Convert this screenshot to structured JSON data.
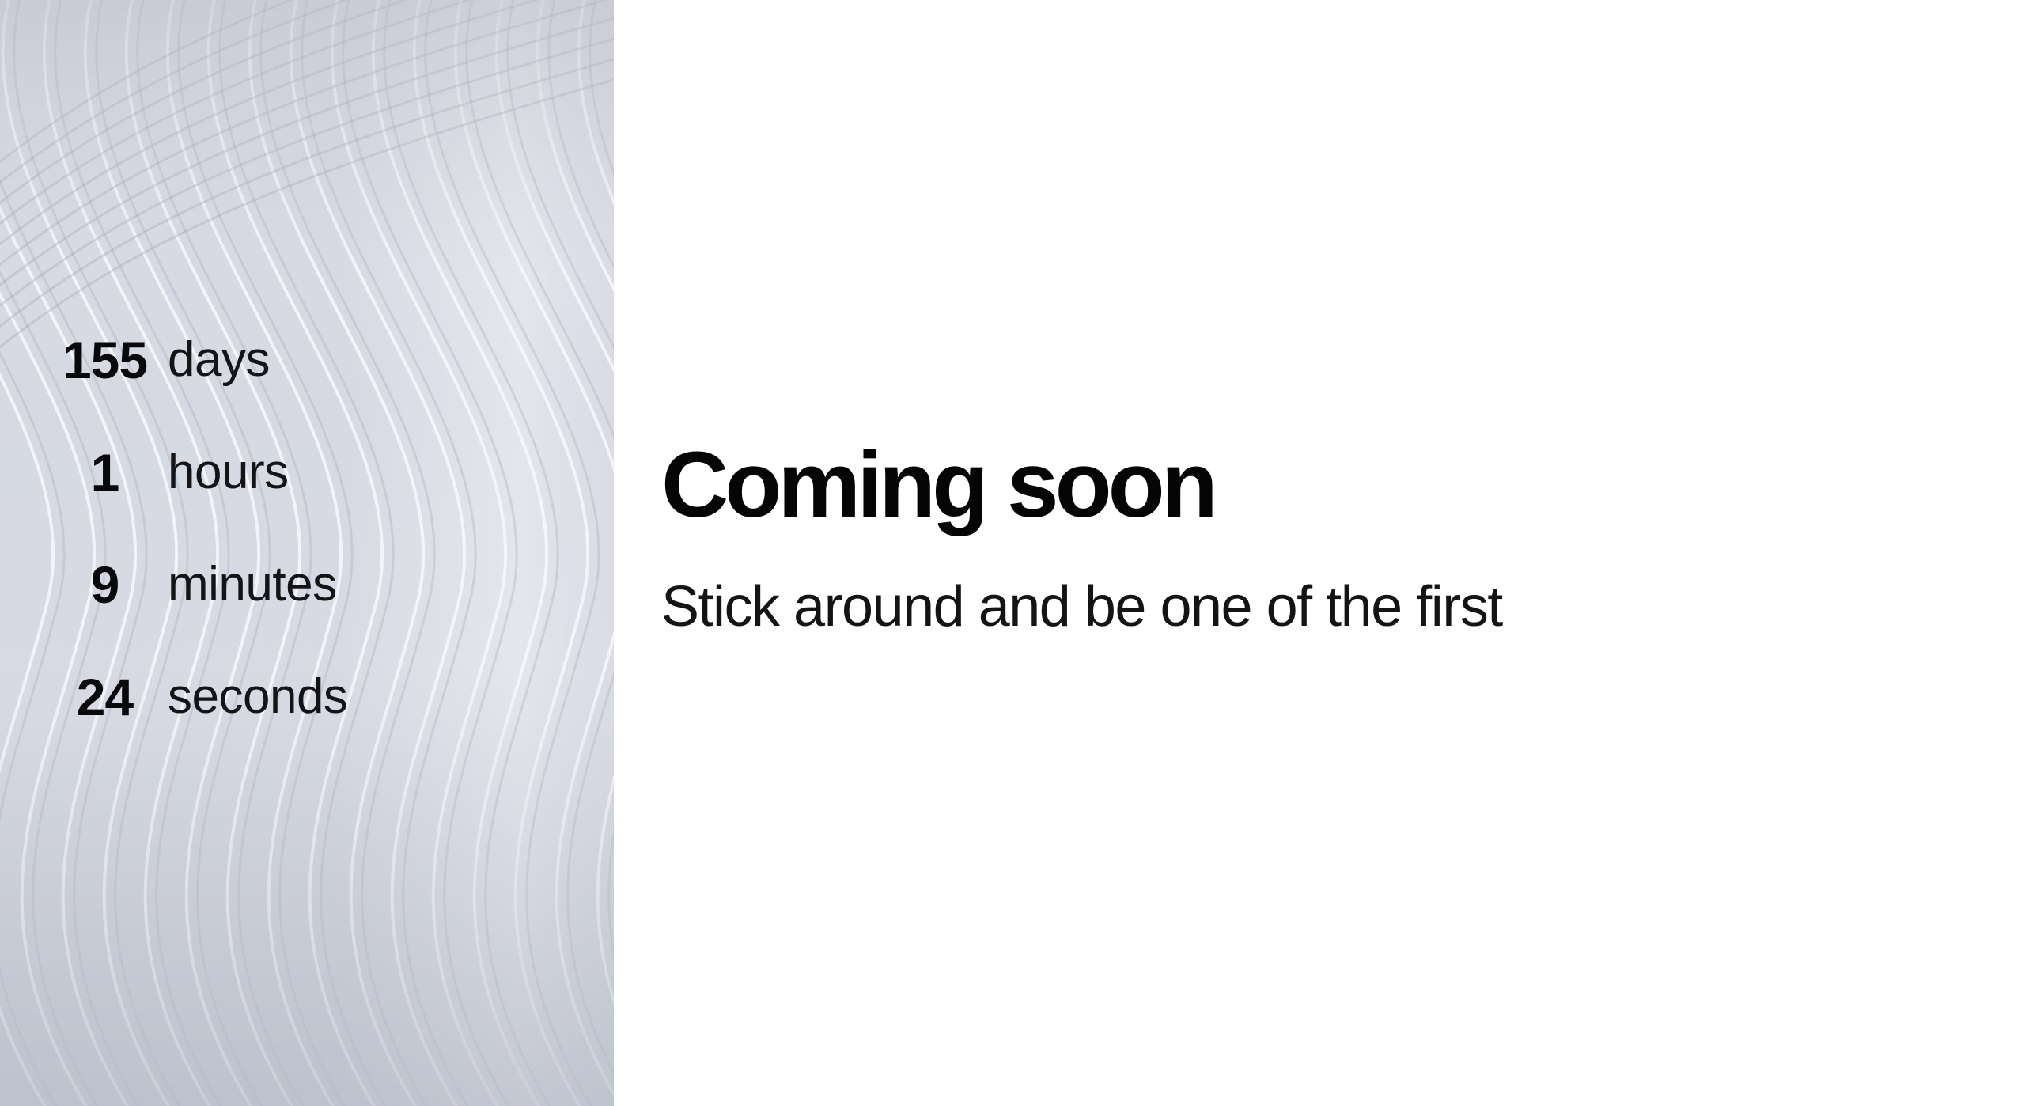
{
  "countdown": {
    "items": [
      {
        "value": "155",
        "unit": "days"
      },
      {
        "value": "1",
        "unit": "hours"
      },
      {
        "value": "9",
        "unit": "minutes"
      },
      {
        "value": "24",
        "unit": "seconds"
      }
    ]
  },
  "hero": {
    "title": "Coming soon",
    "subtitle": "Stick around and be one of the first"
  },
  "colors": {
    "panel_background": "#d8dbe3",
    "text_primary": "#0b0b0c",
    "page_background": "#ffffff"
  }
}
